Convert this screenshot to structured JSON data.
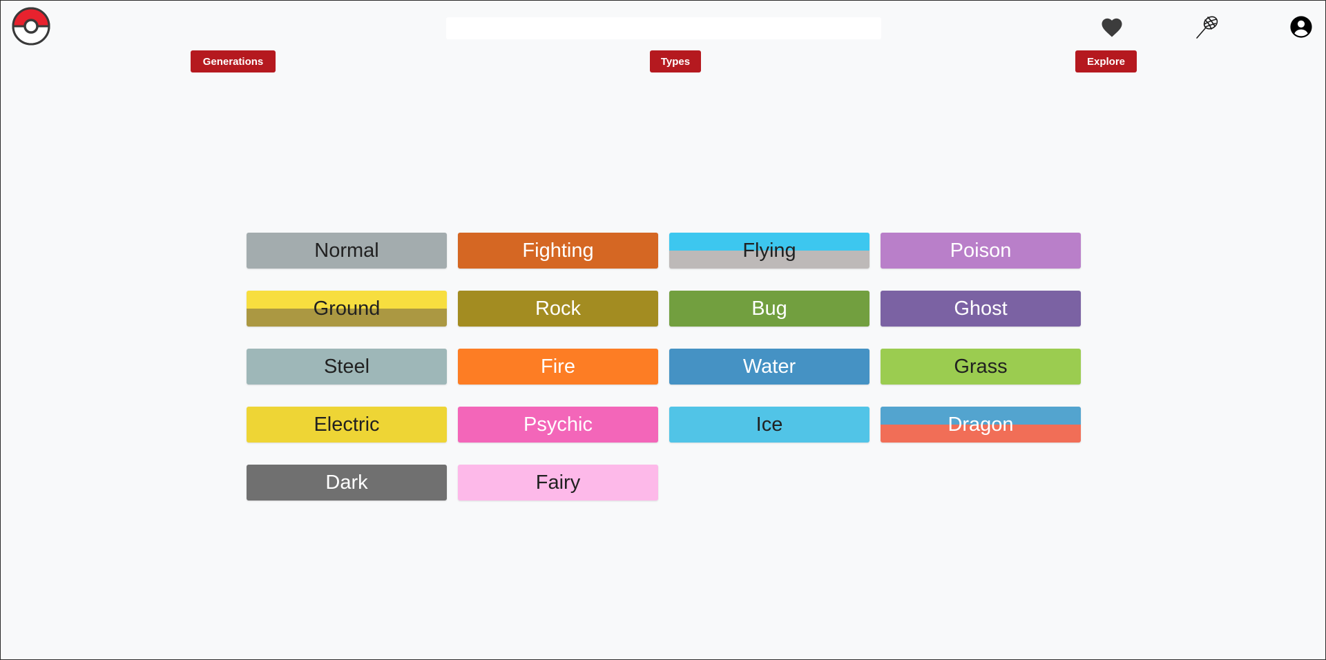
{
  "header": {
    "logo_icon": "pokeball-icon",
    "search": {
      "value": "",
      "placeholder": ""
    },
    "icons": [
      "heart-icon",
      "butterfly-net-icon",
      "account-circle-icon"
    ]
  },
  "nav": {
    "generations_label": "Generations",
    "types_label": "Types",
    "explore_label": "Explore",
    "button_color": "#b5191f"
  },
  "types": [
    {
      "label": "Normal",
      "colors": [
        "#a3acae",
        "#a3acae"
      ],
      "text_color": "#212121"
    },
    {
      "label": "Fighting",
      "colors": [
        "#d56723",
        "#d56723"
      ],
      "text_color": "#ffffff"
    },
    {
      "label": "Flying",
      "colors": [
        "#3dc7ef",
        "#bdb9b8"
      ],
      "text_color": "#212121"
    },
    {
      "label": "Poison",
      "colors": [
        "#b97fc9",
        "#b97fc9"
      ],
      "text_color": "#ffffff"
    },
    {
      "label": "Ground",
      "colors": [
        "#f7de3f",
        "#ab9842"
      ],
      "text_color": "#212121"
    },
    {
      "label": "Rock",
      "colors": [
        "#a38c21",
        "#a38c21"
      ],
      "text_color": "#ffffff"
    },
    {
      "label": "Bug",
      "colors": [
        "#729f3f",
        "#729f3f"
      ],
      "text_color": "#ffffff"
    },
    {
      "label": "Ghost",
      "colors": [
        "#7b62a3",
        "#7b62a3"
      ],
      "text_color": "#ffffff"
    },
    {
      "label": "Steel",
      "colors": [
        "#9eb7b8",
        "#9eb7b8"
      ],
      "text_color": "#212121"
    },
    {
      "label": "Fire",
      "colors": [
        "#fd7d24",
        "#fd7d24"
      ],
      "text_color": "#ffffff"
    },
    {
      "label": "Water",
      "colors": [
        "#4592c4",
        "#4592c4"
      ],
      "text_color": "#ffffff"
    },
    {
      "label": "Grass",
      "colors": [
        "#9bcc50",
        "#9bcc50"
      ],
      "text_color": "#212121"
    },
    {
      "label": "Electric",
      "colors": [
        "#eed535",
        "#eed535"
      ],
      "text_color": "#212121"
    },
    {
      "label": "Psychic",
      "colors": [
        "#f366b9",
        "#f366b9"
      ],
      "text_color": "#ffffff"
    },
    {
      "label": "Ice",
      "colors": [
        "#51c4e7",
        "#51c4e7"
      ],
      "text_color": "#212121"
    },
    {
      "label": "Dragon",
      "colors": [
        "#53a4cf",
        "#f16e57"
      ],
      "text_color": "#ffffff"
    },
    {
      "label": "Dark",
      "colors": [
        "#707070",
        "#707070"
      ],
      "text_color": "#ffffff"
    },
    {
      "label": "Fairy",
      "colors": [
        "#fdb9e9",
        "#fdb9e9"
      ],
      "text_color": "#212121"
    }
  ]
}
